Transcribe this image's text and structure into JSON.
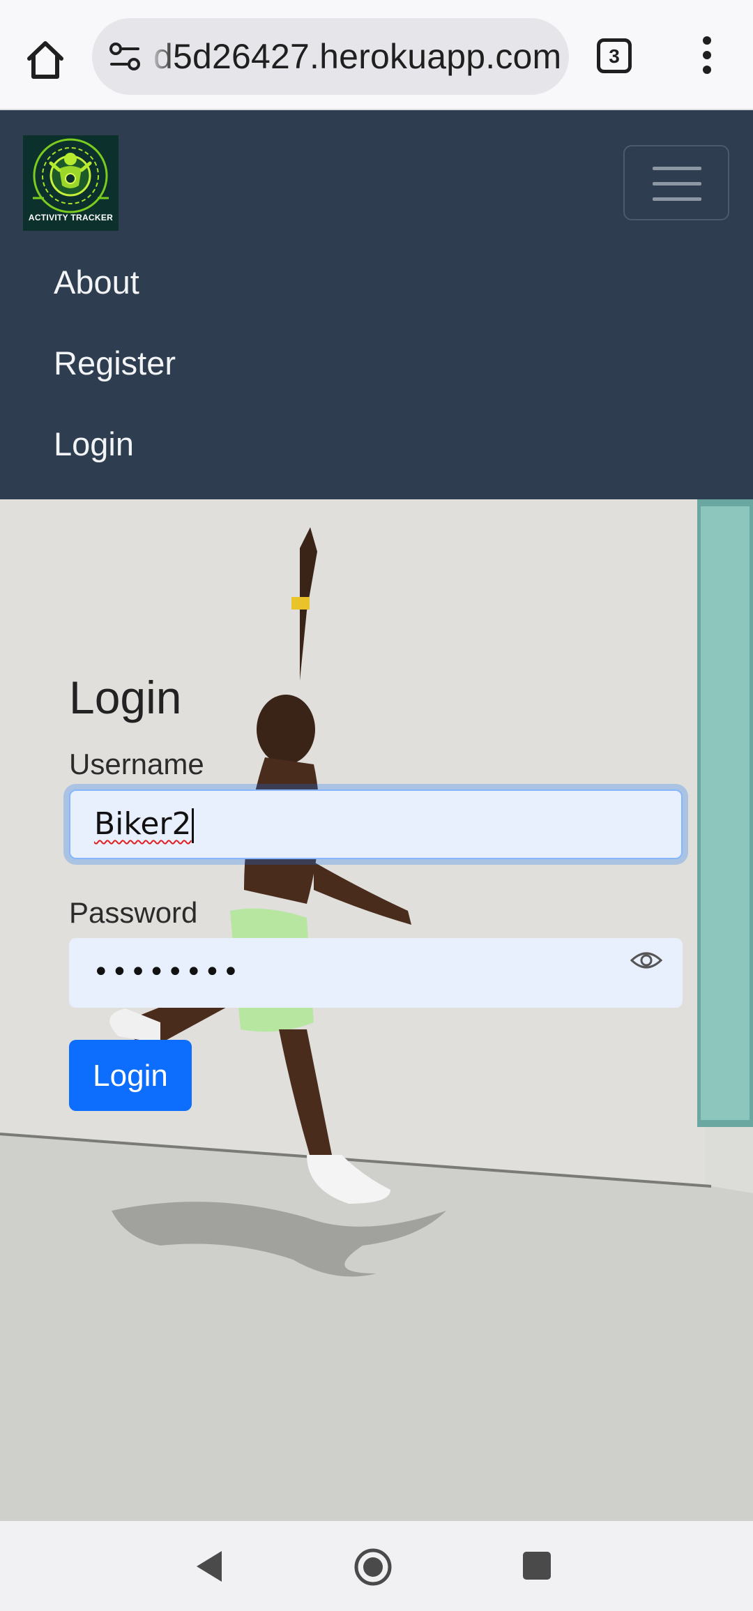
{
  "browser": {
    "url": "d5d26427.herokuapp.com",
    "tab_count": "3",
    "icons": {
      "home": "home-icon",
      "site_info": "site-settings-icon",
      "menu": "more-vert-icon"
    }
  },
  "navbar": {
    "logo_text": "ACTIVITY TRACKER",
    "toggle_icon": "hamburger-icon",
    "links": [
      "About",
      "Register",
      "Login"
    ],
    "background": "#2e3d50"
  },
  "login_form": {
    "title": "Login",
    "username_label": "Username",
    "username_value": "Biker2",
    "password_label": "Password",
    "password_masked": "••••••••",
    "password_toggle_icon": "eye-icon",
    "submit_label": "Login",
    "accent": "#0d6efd",
    "input_background": "#e8f0fe"
  },
  "system_nav": {
    "back_icon": "back-triangle-icon",
    "home_icon": "home-circle-icon",
    "recents_icon": "recents-square-icon"
  }
}
